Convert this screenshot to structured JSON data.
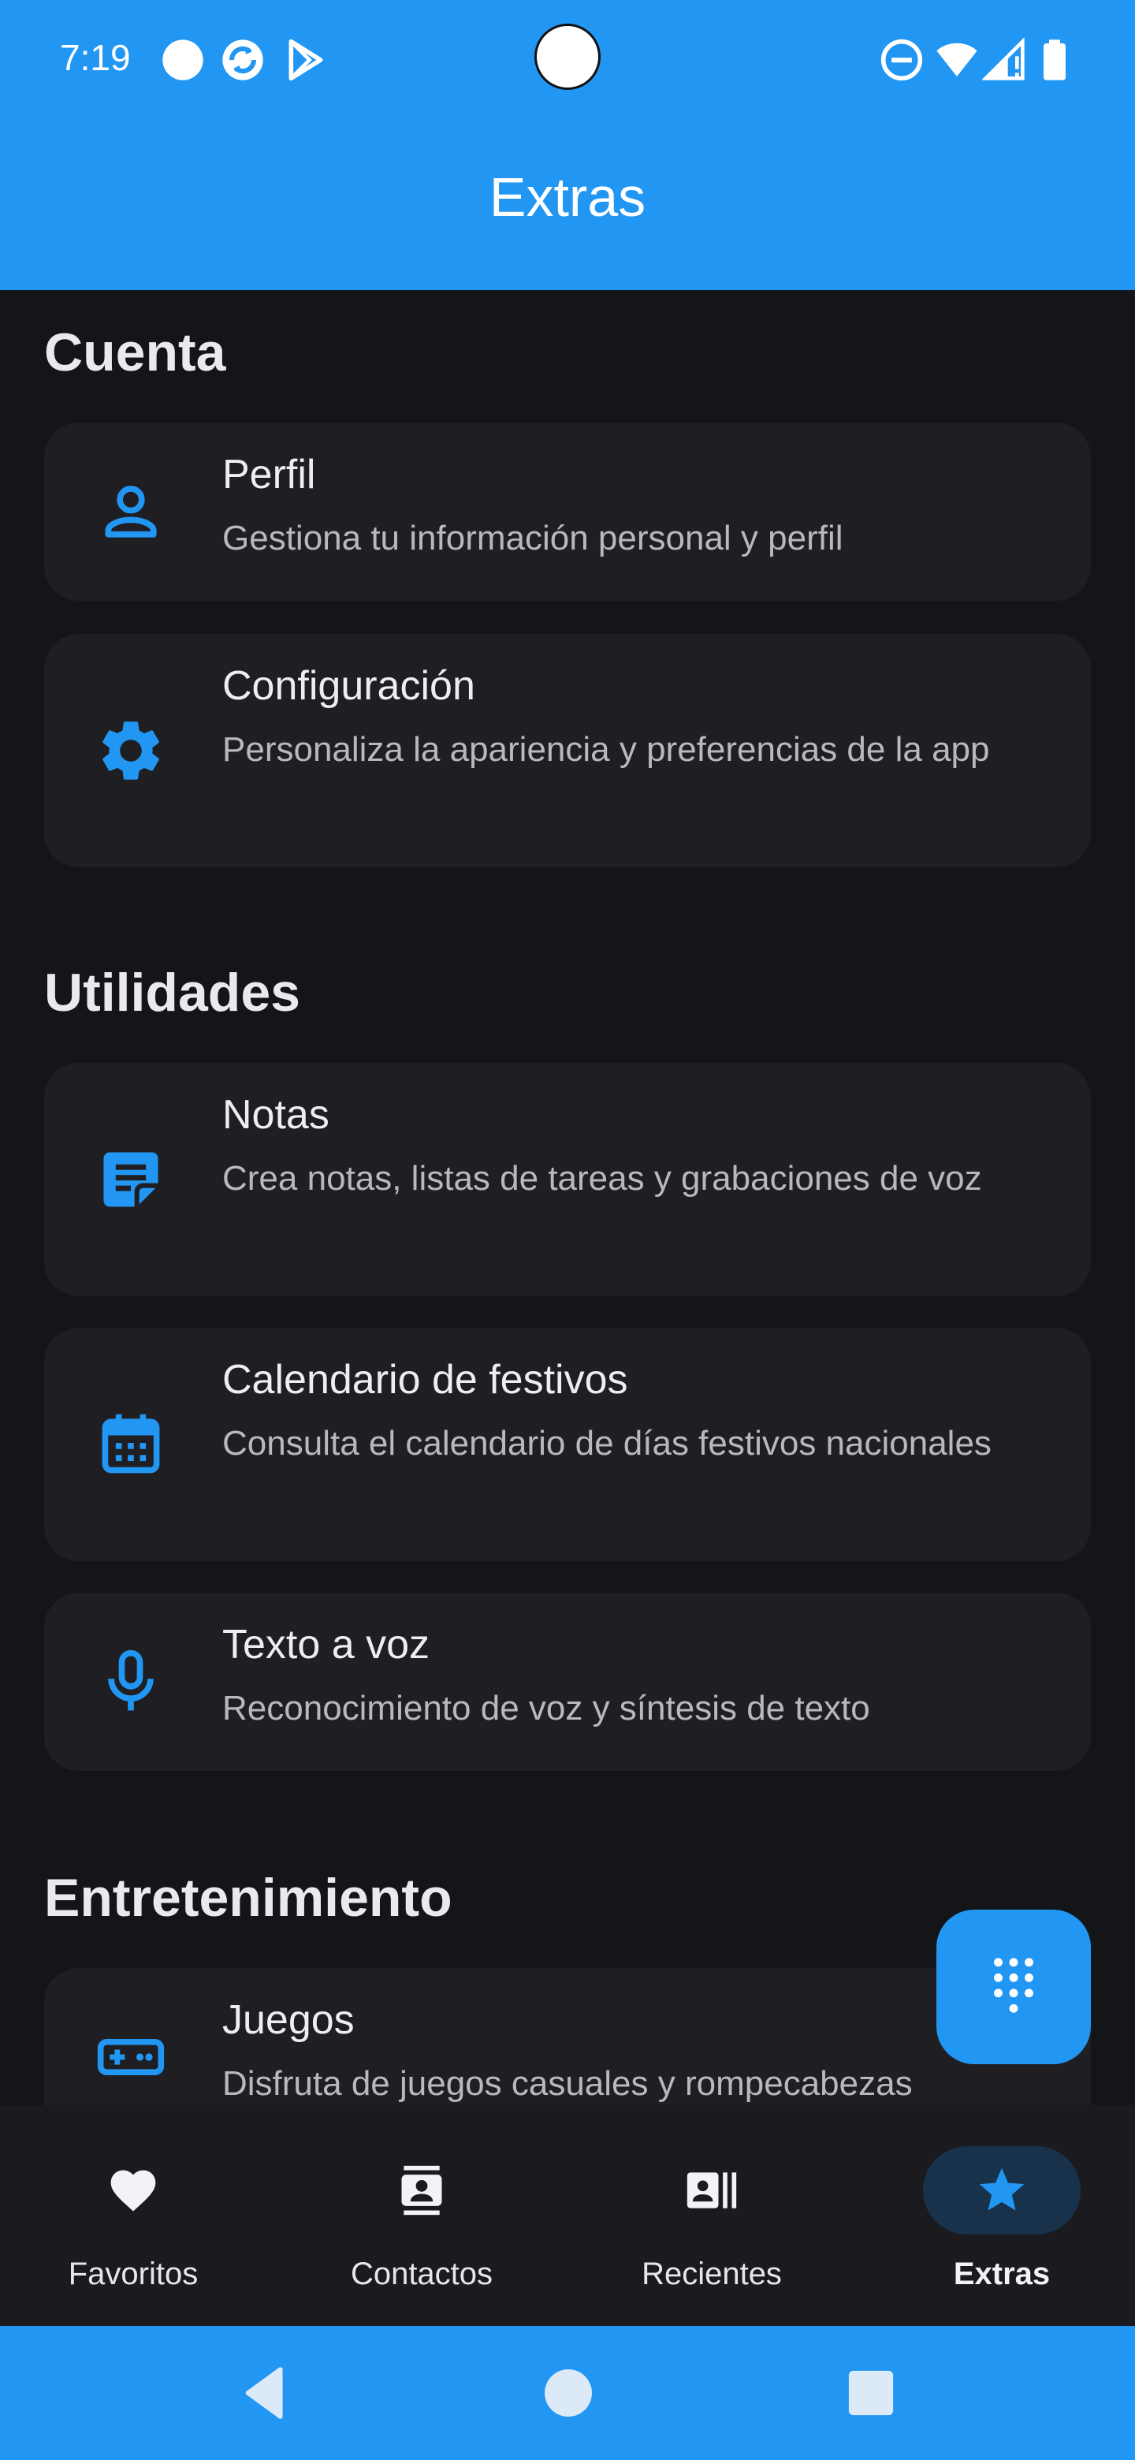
{
  "status_bar": {
    "time": "7:19"
  },
  "app_bar": {
    "title": "Extras"
  },
  "sections": [
    {
      "title": "Cuenta",
      "items": [
        {
          "title": "Perfil",
          "description": "Gestiona tu información personal y perfil",
          "icon": "person-icon"
        },
        {
          "title": "Configuración",
          "description": "Personaliza la apariencia y preferencias de la app",
          "icon": "gear-icon"
        }
      ]
    },
    {
      "title": "Utilidades",
      "items": [
        {
          "title": "Notas",
          "description": "Crea notas, listas de tareas y grabaciones de voz",
          "icon": "note-icon"
        },
        {
          "title": "Calendario de festivos",
          "description": "Consulta el calendario de días festivos nacionales",
          "icon": "calendar-icon"
        },
        {
          "title": "Texto a voz",
          "description": "Reconocimiento de voz y síntesis de texto",
          "icon": "microphone-icon"
        }
      ]
    },
    {
      "title": "Entretenimiento",
      "items": [
        {
          "title": "Juegos",
          "description": "Disfruta de juegos casuales y rompecabezas",
          "icon": "gamepad-icon"
        }
      ]
    }
  ],
  "fab": {
    "icon": "dialpad-icon"
  },
  "bottom_nav": {
    "items": [
      {
        "label": "Favoritos",
        "icon": "heart-icon",
        "active": false
      },
      {
        "label": "Contactos",
        "icon": "contacts-icon",
        "active": false
      },
      {
        "label": "Recientes",
        "icon": "recents-icon",
        "active": false
      },
      {
        "label": "Extras",
        "icon": "star-icon",
        "active": true
      }
    ]
  },
  "colors": {
    "primary": "#2196f3",
    "background": "#141518",
    "card": "#1f1f23",
    "nav_active_pill": "#17324a"
  }
}
